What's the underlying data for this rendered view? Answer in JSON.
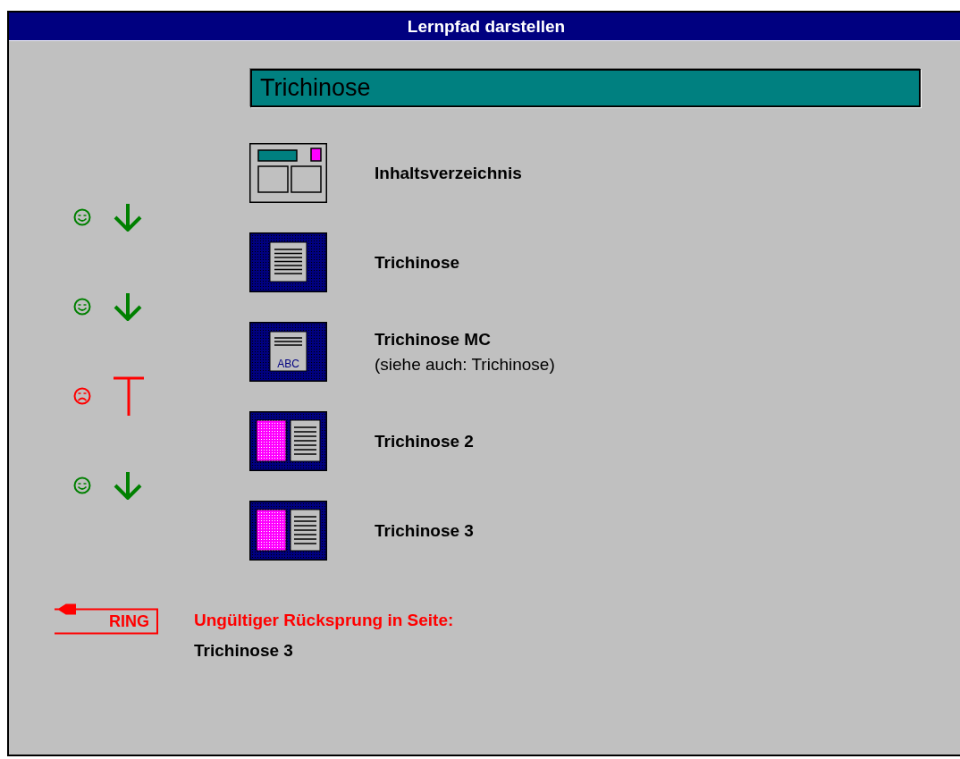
{
  "window": {
    "title": "Lernpfad darstellen"
  },
  "course_title": "Trichinose",
  "pages": [
    {
      "kind": "toc",
      "title": "Inhaltsverzeichnis"
    },
    {
      "kind": "text",
      "title": "Trichinose"
    },
    {
      "kind": "mc",
      "title": "Trichinose MC",
      "note": "(siehe auch: Trichinose)",
      "icon_label": "ABC"
    },
    {
      "kind": "split",
      "title": "Trichinose 2"
    },
    {
      "kind": "split",
      "title": "Trichinose 3"
    }
  ],
  "transitions": [
    {
      "kind": "ok"
    },
    {
      "kind": "ok"
    },
    {
      "kind": "blocked"
    },
    {
      "kind": "ok"
    }
  ],
  "error": {
    "badge": "RING",
    "message": "Ungültiger Rücksprung in Seite:",
    "page": "Trichinose 3"
  }
}
